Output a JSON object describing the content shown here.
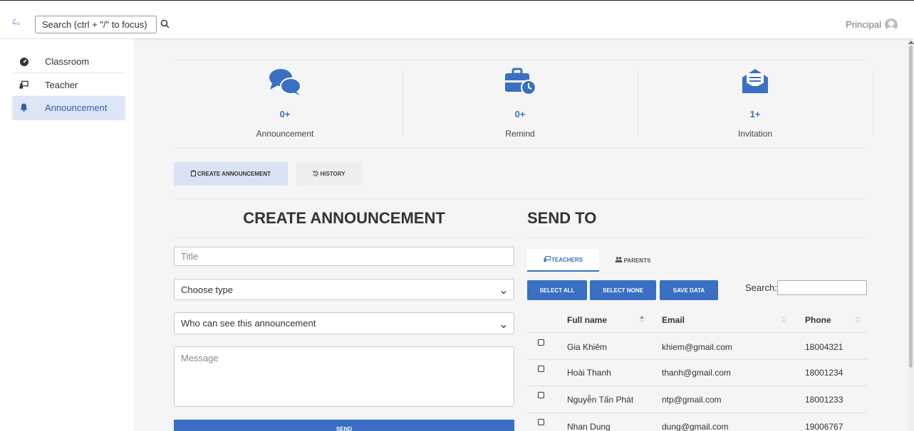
{
  "topbar": {
    "logo": "ℒ₁",
    "search_placeholder": "Search (ctrl + \"/\" to focus)",
    "user": "Principal",
    "search_icon": "magnifier-icon",
    "avatar_icon": "user-avatar-icon"
  },
  "sidebar": {
    "items": [
      {
        "label": "Classroom",
        "icon": "gauge-icon",
        "active": false
      },
      {
        "label": "Teacher",
        "icon": "chalkboard-teacher-icon",
        "active": false
      },
      {
        "label": "Announcement",
        "icon": "bell-icon",
        "active": true
      }
    ]
  },
  "stats": [
    {
      "count": "0+",
      "label": "Announcement",
      "icon": "comments-icon"
    },
    {
      "count": "0+",
      "label": "Remind",
      "icon": "briefcase-clock-icon"
    },
    {
      "count": "1+",
      "label": "Invitation",
      "icon": "envelope-open-text-icon"
    }
  ],
  "tabs": {
    "create": "CREATE ANNOUNCEMENT",
    "history": "HISTORY"
  },
  "form": {
    "title": "CREATE ANNOUNCEMENT",
    "title_placeholder": "Title",
    "type_placeholder": "Choose type",
    "visibility_placeholder": "Who can see this announcement",
    "message_placeholder": "Message",
    "send_label": "SEND"
  },
  "send_to": {
    "title": "SEND TO",
    "tabs": {
      "teachers": "TEACHERS",
      "parents": "PARENTS"
    },
    "buttons": {
      "select_all": "SELECT ALL",
      "select_none": "SELECT NONE",
      "save": "SAVE DATA"
    },
    "search_label": "Search:",
    "columns": [
      "Full name",
      "Email",
      "Phone"
    ],
    "rows": [
      {
        "name": "Gia Khiêm",
        "email": "khiem@gmail.com",
        "phone": "18004321"
      },
      {
        "name": "Hoài Thanh",
        "email": "thanh@gmail.com",
        "phone": "18001234"
      },
      {
        "name": "Nguyễn Tấn Phát",
        "email": "ntp@gmail.com",
        "phone": "18001233"
      },
      {
        "name": "Nhan Dung",
        "email": "dung@gmail.com",
        "phone": "19006767"
      }
    ]
  },
  "colors": {
    "accent": "#3a6fc4",
    "active_bg": "#dce6f6"
  }
}
